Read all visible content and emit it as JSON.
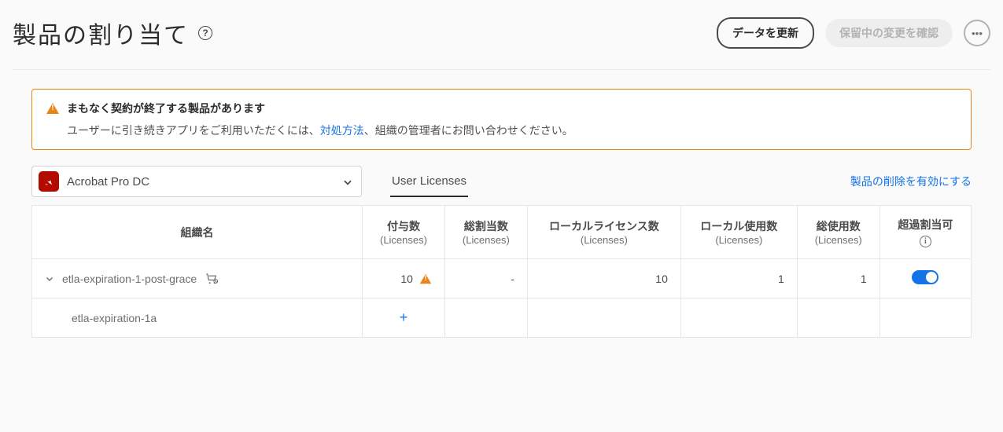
{
  "header": {
    "title": "製品の割り当て",
    "help_glyph": "?",
    "refresh_label": "データを更新",
    "pending_label": "保留中の変更を確認",
    "more_glyph": "•••"
  },
  "alert": {
    "title": "まもなく契約が終了する製品があります",
    "body_prefix": "ユーザーに引き続きアプリをご利用いただくには、",
    "body_link": "対処方法",
    "body_suffix": "、組織の管理者にお問い合わせください。"
  },
  "toolbar": {
    "product_name": "Acrobat Pro DC",
    "tab_label": "User Licenses",
    "enable_delete_label": "製品の削除を有効にする"
  },
  "table": {
    "headers": {
      "org": "組織名",
      "granted": "付与数",
      "total_alloc": "総割当数",
      "local_lic": "ローカルライセンス数",
      "local_use": "ローカル使用数",
      "total_use": "総使用数",
      "over_alloc": "超過割当可",
      "licenses_sub": "(Licenses)"
    },
    "rows": [
      {
        "type": "parent",
        "name": "etla-expiration-1-post-grace",
        "granted": "10",
        "granted_warn": true,
        "total_alloc": "-",
        "local_lic": "10",
        "local_use": "1",
        "total_use": "1",
        "toggle_on": true
      },
      {
        "type": "child",
        "name": "etla-expiration-1a",
        "granted_plus": true
      }
    ],
    "info_glyph": "i",
    "plus_glyph": "+"
  }
}
